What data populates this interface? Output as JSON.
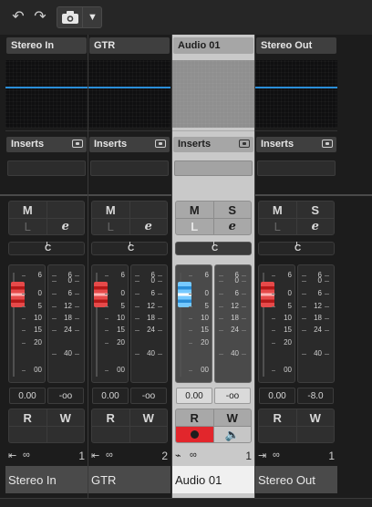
{
  "toolbar": {
    "undo_icon": "undo-icon",
    "redo_icon": "redo-icon",
    "snapshot_icon": "camera-icon",
    "dropdown_icon": "dropdown-arrow-icon",
    "undo_glyph": "↶",
    "redo_glyph": "↷",
    "dropdown_glyph": "▼"
  },
  "buttons": {
    "mute": "M",
    "solo": "S",
    "listen": "L",
    "edit": "e",
    "read": "R",
    "write": "W"
  },
  "inserts_label": "Inserts",
  "pan_label": "C",
  "meter_scale": [
    "00",
    "40",
    "24",
    "18",
    "12",
    "6",
    "0",
    "6"
  ],
  "fader_scale_left": [
    "6",
    "0",
    "5",
    "10",
    "15",
    "20",
    "00"
  ],
  "colors": {
    "accent_blue": "#2a8ed8",
    "fader_red": "#e64a4a",
    "record_red": "#e2262c",
    "selected_bg": "#c9c9c9"
  },
  "channels": [
    {
      "name": "Stereo In",
      "volume": "0.00",
      "peak": "-oo",
      "number": "1",
      "fader_db": 0,
      "show_solo": false
    },
    {
      "name": "GTR",
      "volume": "0.00",
      "peak": "-oo",
      "number": "2",
      "fader_db": 0,
      "show_solo": false
    },
    {
      "name": "Audio 01",
      "volume": "0.00",
      "peak": "-oo",
      "number": "1",
      "fader_db": 0,
      "show_solo": true,
      "selected": true
    },
    {
      "name": "Stereo Out",
      "volume": "0.00",
      "peak": "-8.0",
      "number": "1",
      "fader_db": 0,
      "show_solo": true
    }
  ]
}
